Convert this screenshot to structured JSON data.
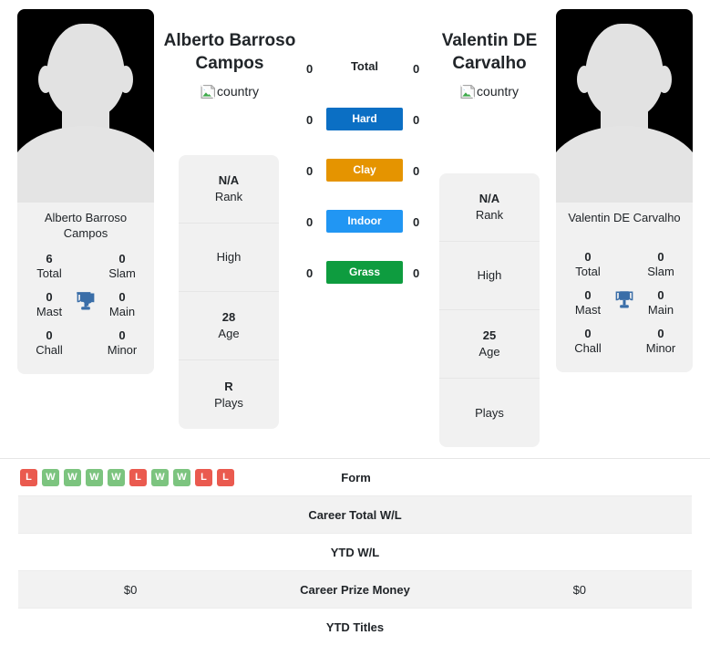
{
  "players": {
    "left": {
      "name": "Alberto Barroso Campos",
      "card_name": "Alberto Barroso Campos",
      "country_alt": "country",
      "titles": [
        {
          "value": "6",
          "label": "Total"
        },
        {
          "value": "0",
          "label": "Slam"
        },
        {
          "value": "0",
          "label": "Mast"
        },
        {
          "value": "0",
          "label": "Main"
        },
        {
          "value": "0",
          "label": "Chall"
        },
        {
          "value": "0",
          "label": "Minor"
        }
      ],
      "info": [
        {
          "value": "N/A",
          "label": "Rank"
        },
        {
          "value": "",
          "label": "High"
        },
        {
          "value": "28",
          "label": "Age"
        },
        {
          "value": "R",
          "label": "Plays"
        }
      ]
    },
    "right": {
      "name": "Valentin DE Carvalho",
      "card_name": "Valentin DE Carvalho",
      "country_alt": "country",
      "titles": [
        {
          "value": "0",
          "label": "Total"
        },
        {
          "value": "0",
          "label": "Slam"
        },
        {
          "value": "0",
          "label": "Mast"
        },
        {
          "value": "0",
          "label": "Main"
        },
        {
          "value": "0",
          "label": "Chall"
        },
        {
          "value": "0",
          "label": "Minor"
        }
      ],
      "info": [
        {
          "value": "N/A",
          "label": "Rank"
        },
        {
          "value": "",
          "label": "High"
        },
        {
          "value": "25",
          "label": "Age"
        },
        {
          "value": "",
          "label": "Plays"
        }
      ]
    }
  },
  "surfaces": [
    {
      "label": "Total",
      "left": "0",
      "right": "0",
      "color": "",
      "style": "plain"
    },
    {
      "label": "Hard",
      "left": "0",
      "right": "0",
      "color": "#0b6fc4",
      "style": "pill"
    },
    {
      "label": "Clay",
      "left": "0",
      "right": "0",
      "color": "#e59400",
      "style": "pill"
    },
    {
      "label": "Indoor",
      "left": "0",
      "right": "0",
      "color": "#2196f3",
      "style": "pill"
    },
    {
      "label": "Grass",
      "left": "0",
      "right": "0",
      "color": "#0e9c3f",
      "style": "pill"
    }
  ],
  "stats_rows": [
    {
      "label": "Form",
      "left": "",
      "right": "",
      "left_form": [
        "L",
        "W",
        "W",
        "W",
        "W",
        "L",
        "W",
        "W",
        "L",
        "L"
      ],
      "shaded": false
    },
    {
      "label": "Career Total W/L",
      "left": "",
      "right": "",
      "shaded": true
    },
    {
      "label": "YTD W/L",
      "left": "",
      "right": "",
      "shaded": false
    },
    {
      "label": "Career Prize Money",
      "left": "$0",
      "right": "$0",
      "shaded": true
    },
    {
      "label": "YTD Titles",
      "left": "",
      "right": "",
      "shaded": false
    }
  ],
  "colors": {
    "win": "#7cc47f",
    "loss": "#ea5a4f",
    "card_bg": "#f1f1f1",
    "row_alt": "#f2f2f2"
  }
}
